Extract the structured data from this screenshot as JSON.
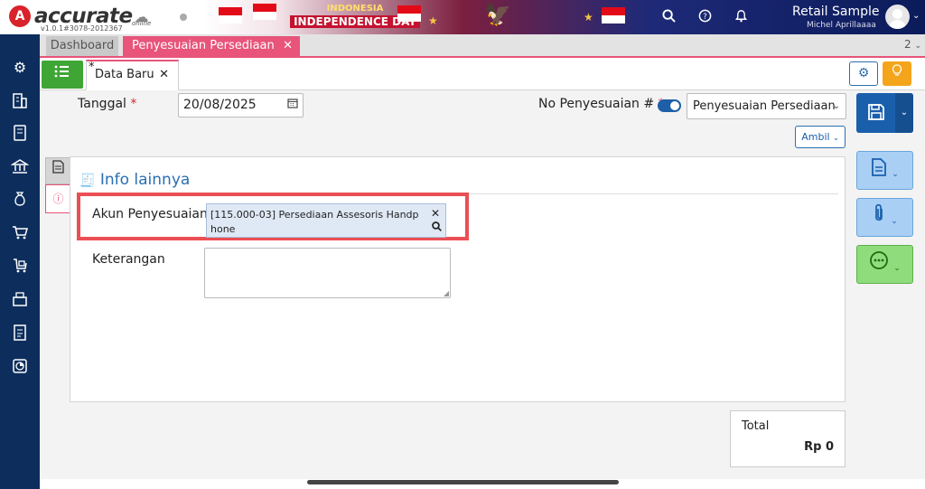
{
  "app": {
    "logo_letter": "A",
    "brand": "accurate",
    "brand_suffix": "online",
    "version": "v1.0.1#3078-2012367"
  },
  "banner": {
    "line1": "INDONESIA",
    "line2": "INDEPENDENCE DAY"
  },
  "user": {
    "company": "Retail Sample",
    "name": "Michel Aprillaaaa"
  },
  "tabs": {
    "items": [
      {
        "label": "Dashboard"
      },
      {
        "label": "Penyesuaian Persediaan",
        "close": "✕"
      }
    ],
    "count": "2"
  },
  "subtab": {
    "modified_marker": "*",
    "label": "Data Baru",
    "close": "✕"
  },
  "form": {
    "tanggal_label": "Tanggal",
    "required_mark": "*",
    "tanggal_value": "20/08/2025",
    "no_label": "No Penyesuaian #",
    "no_select_value": "Penyesuaian Persediaan",
    "ambil_label": "Ambil"
  },
  "panel": {
    "title": "Info lainnya",
    "akun_label": "Akun Penyesuaian",
    "akun_value": "[115.000-03] Persediaan Assesoris Handphone",
    "keterangan_label": "Keterangan"
  },
  "total": {
    "label": "Total",
    "value": "Rp 0"
  },
  "colors": {
    "accent_pink": "#e8547a",
    "primary_blue": "#1a5fac",
    "sidebar_navy": "#0d2e5c",
    "highlight_red": "#ea4f54",
    "green": "#3fa636"
  }
}
